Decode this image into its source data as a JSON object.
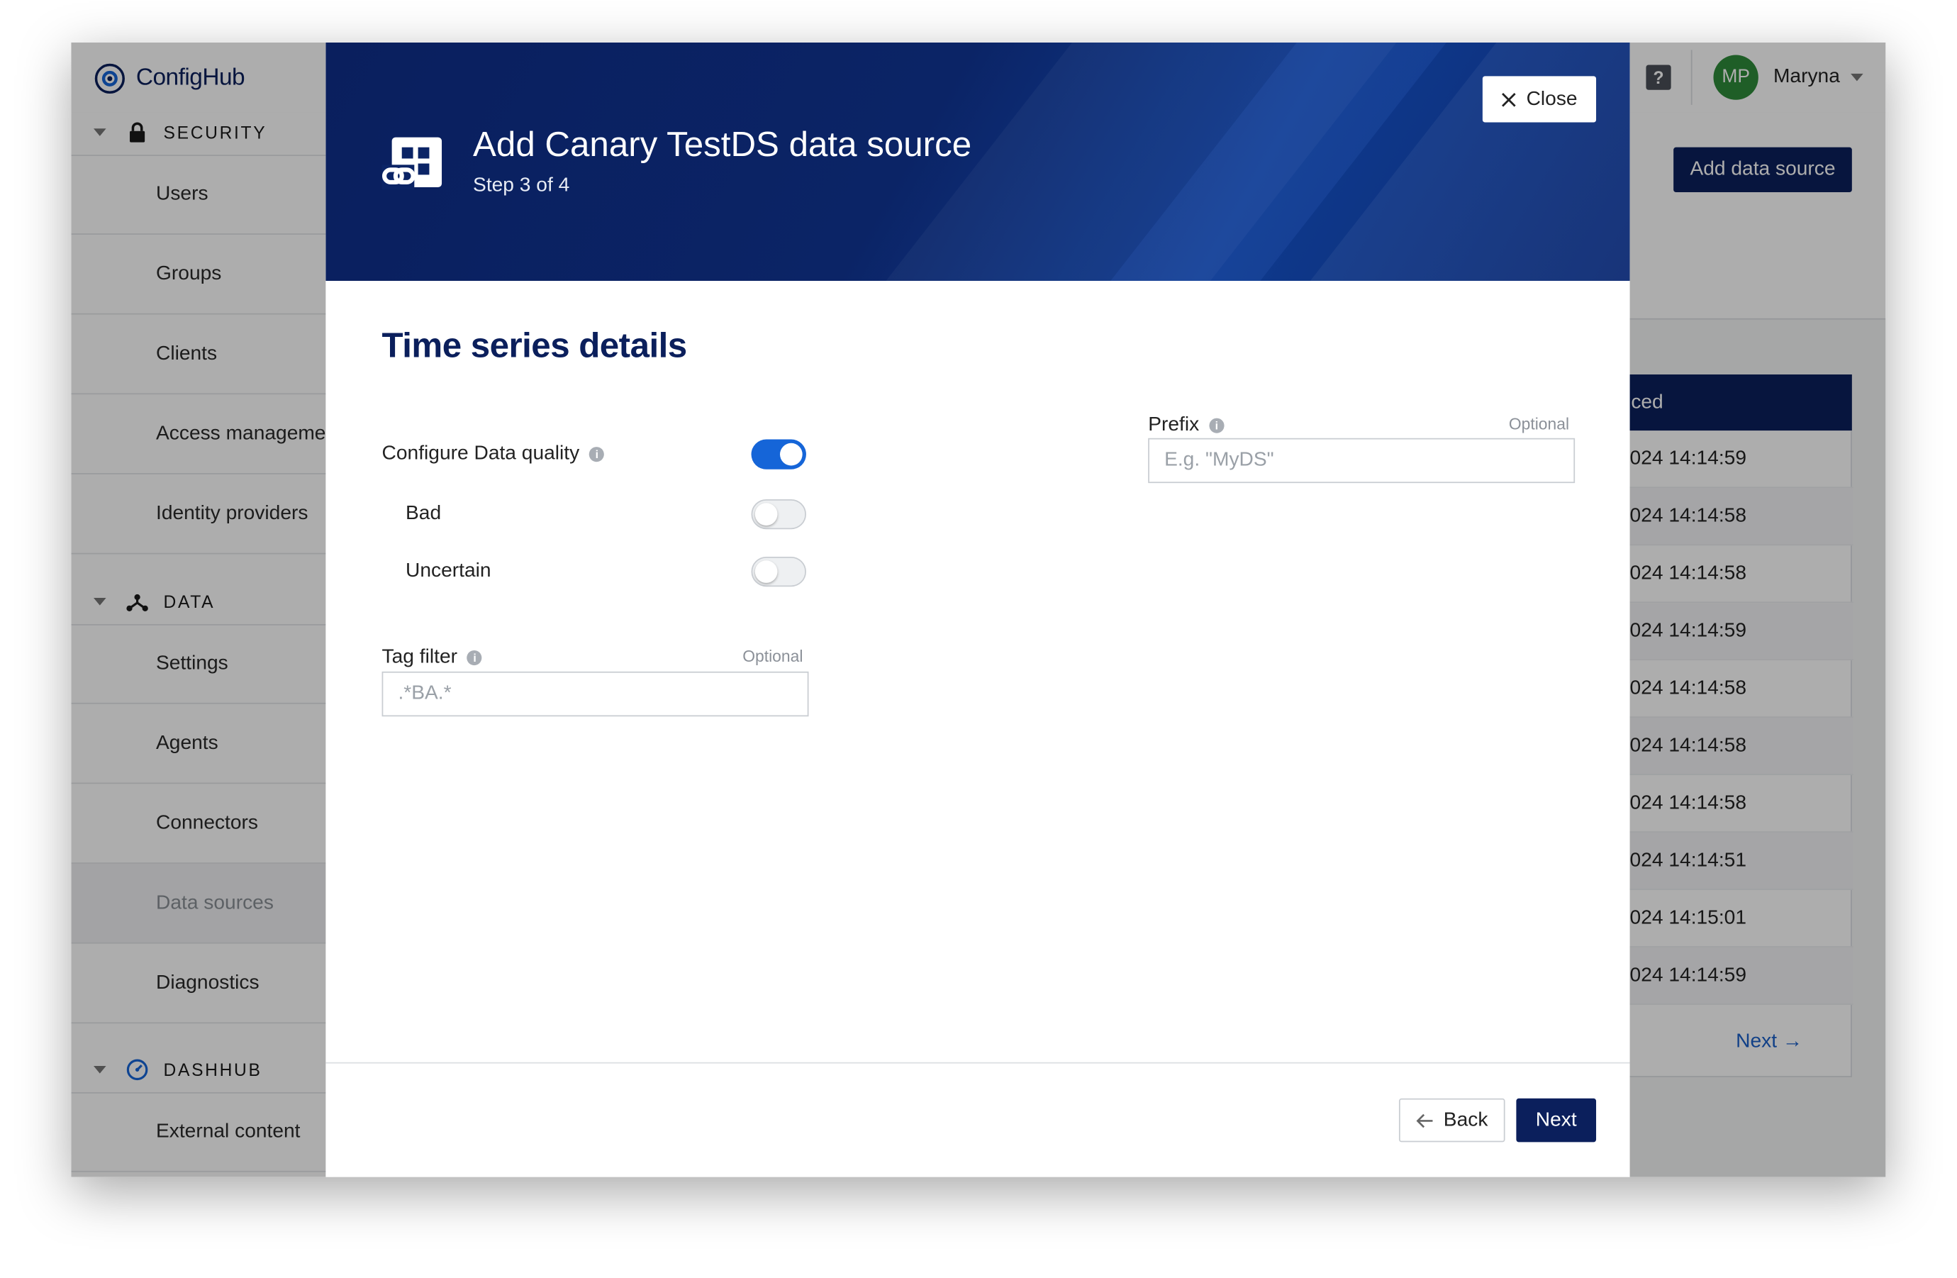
{
  "app": {
    "name": "ConfigHub"
  },
  "header": {
    "user_initials": "MP",
    "user_name": "Maryna"
  },
  "sidebar": {
    "security": {
      "label": "SECURITY",
      "items": [
        "Users",
        "Groups",
        "Clients",
        "Access managemen",
        "Identity providers"
      ]
    },
    "data": {
      "label": "DATA",
      "items": [
        "Settings",
        "Agents",
        "Connectors",
        "Data sources",
        "Diagnostics"
      ],
      "active": "Data sources"
    },
    "dashhub": {
      "label": "DASHHUB",
      "items": [
        "External content"
      ]
    }
  },
  "background": {
    "add_button": "Add data source",
    "table_header_fragment": "ced",
    "rows": [
      "024 14:14:59",
      "024 14:14:58",
      "024 14:14:58",
      "024 14:14:59",
      "024 14:14:58",
      "024 14:14:58",
      "024 14:14:58",
      "024 14:14:51",
      "024 14:15:01",
      "024 14:14:59"
    ],
    "next_link": "Next →"
  },
  "modal": {
    "title": "Add Canary TestDS data source",
    "step": "Step 3 of 4",
    "close_label": "Close",
    "section_title": "Time series details",
    "data_quality": {
      "label": "Configure Data quality",
      "enabled": true,
      "options": [
        {
          "label": "Bad",
          "enabled": false
        },
        {
          "label": "Uncertain",
          "enabled": false
        }
      ]
    },
    "tag_filter": {
      "label": "Tag filter",
      "optional": "Optional",
      "placeholder": ".*BA.*",
      "value": ""
    },
    "prefix": {
      "label": "Prefix",
      "optional": "Optional",
      "placeholder": "E.g. \"MyDS\"",
      "value": ""
    },
    "back_label": "Back",
    "next_label": "Next"
  },
  "colors": {
    "brand_navy": "#0b1f5c",
    "toggle_on": "#1565d8",
    "avatar": "#2e8b3a"
  }
}
